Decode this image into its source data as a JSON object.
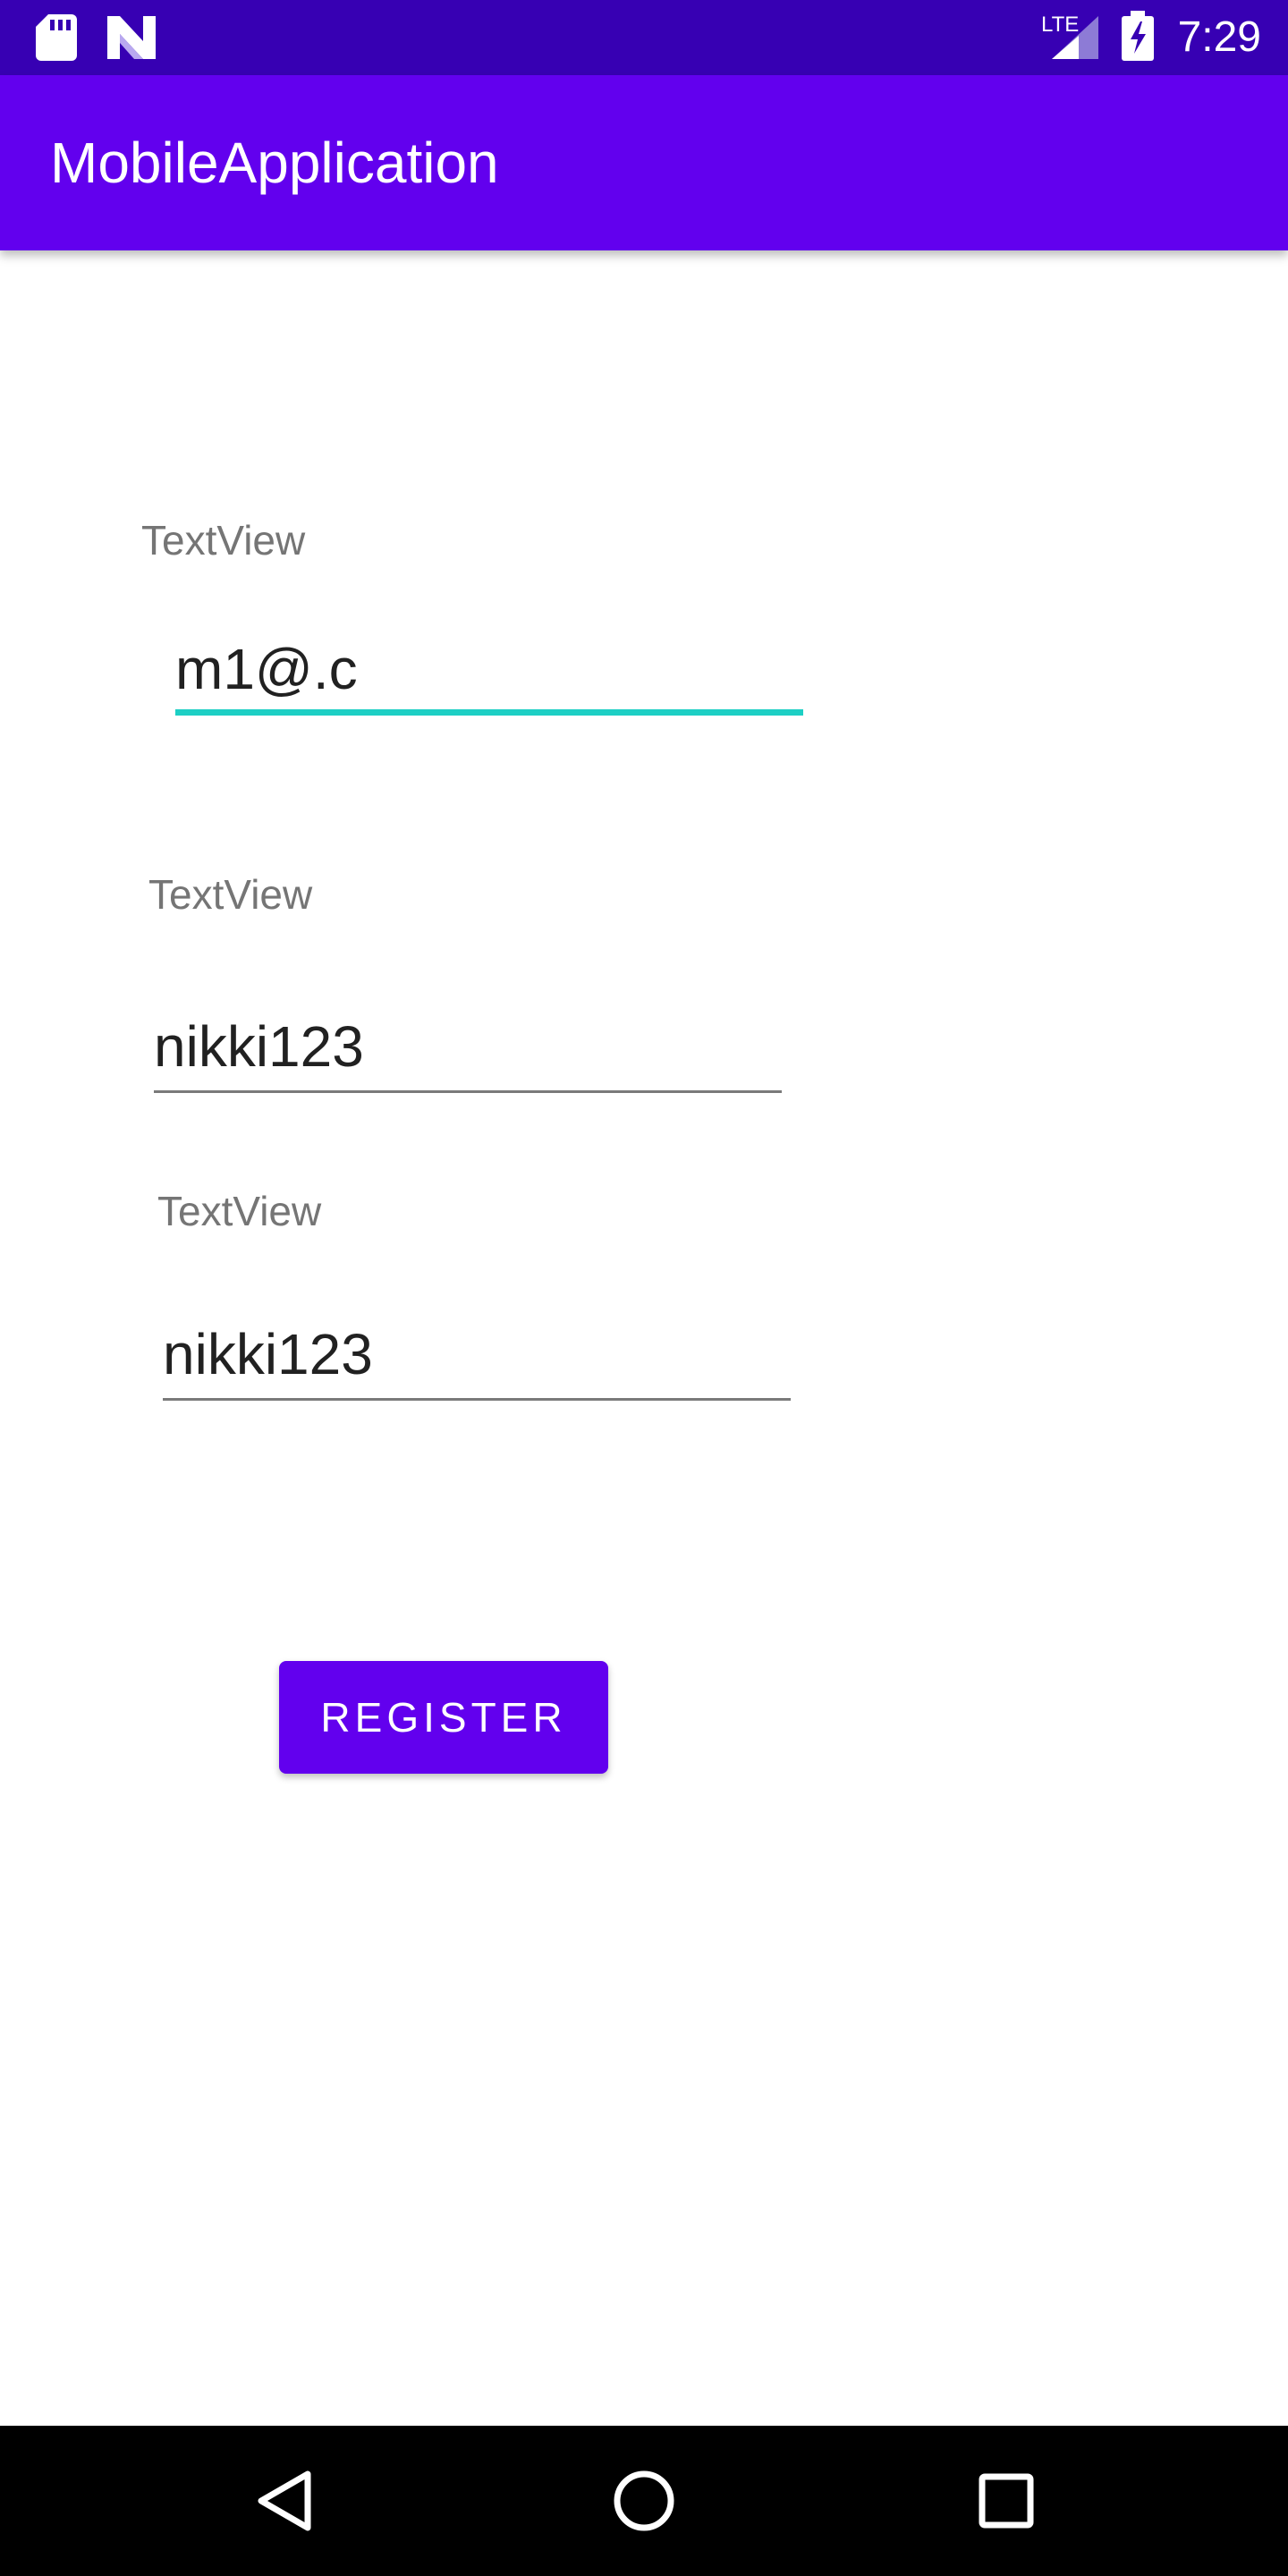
{
  "status_bar": {
    "time": "7:29",
    "network": "LTE",
    "icons": [
      "sd-card-icon",
      "n-logo-icon",
      "lte-signal-icon",
      "battery-charging-icon"
    ],
    "background": "#3700B3"
  },
  "app_bar": {
    "title": "MobileApplication",
    "background": "#6200EE"
  },
  "form": {
    "fields": [
      {
        "label": "TextView",
        "value": "m1@.c",
        "focused": true
      },
      {
        "label": "TextView",
        "value": "nikki123",
        "focused": false
      },
      {
        "label": "TextView",
        "value": "nikki123",
        "focused": false
      }
    ],
    "accent_color": "#1DCFC4"
  },
  "register_button": {
    "label": "REGISTER",
    "background": "#6200EE"
  },
  "nav_bar": {
    "buttons": [
      "back-icon",
      "home-icon",
      "recents-icon"
    ]
  }
}
